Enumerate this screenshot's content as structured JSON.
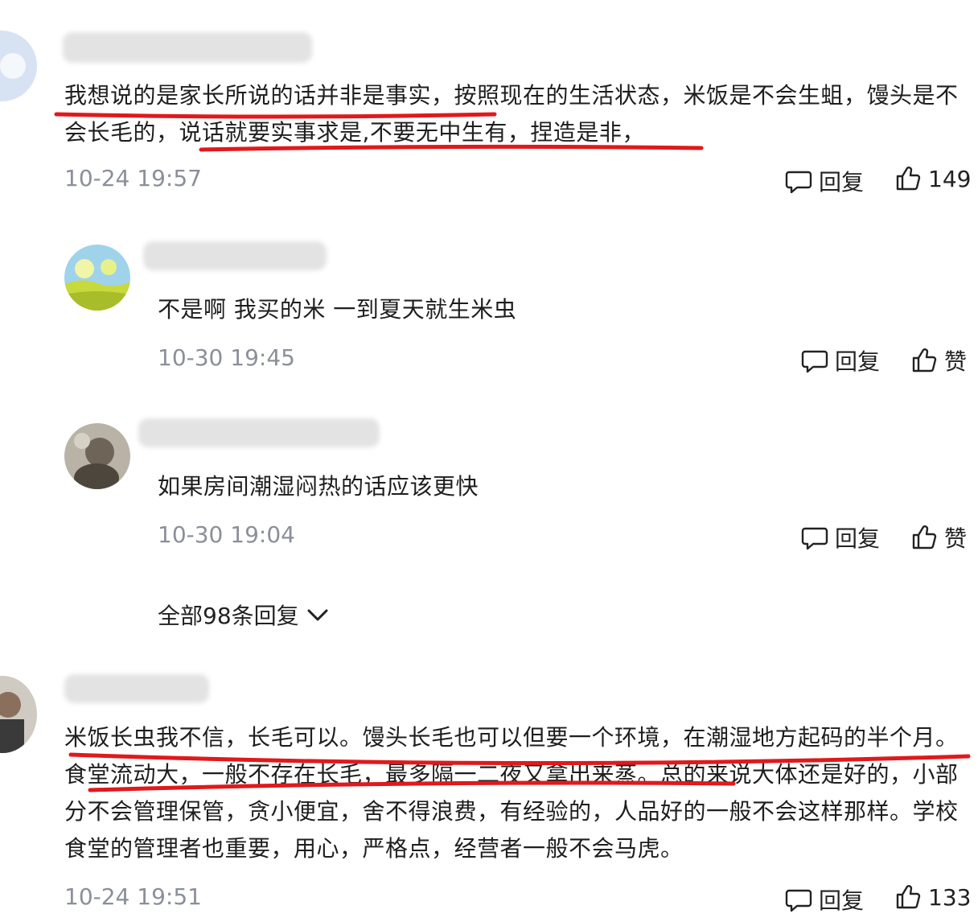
{
  "comments": [
    {
      "text": "我想说的是家长所说的话并非是事实，按照现在的生活状态，米饭是不会生蛆，馒头是不会长毛的，说话就要实事求是,不要无中生有，捏造是非，",
      "time": "10-24 19:57",
      "reply_label": "回复",
      "like_label": "149"
    },
    {
      "text": "不是啊 我买的米 一到夏天就生米虫",
      "time": "10-30 19:45",
      "reply_label": "回复",
      "like_label": "赞"
    },
    {
      "text": "如果房间潮湿闷热的话应该更快",
      "time": "10-30 19:04",
      "reply_label": "回复",
      "like_label": "赞"
    },
    {
      "text": "米饭长虫我不信，长毛可以。馒头长毛也可以但要一个环境，在潮湿地方起码的半个月。食堂流动大，一般不存在长毛，最多隔一二夜又拿出来蒸。总的来说大体还是好的，小部分不会管理保管，贪小便宜，舍不得浪费，有经验的，人品好的一般不会这样那样。学校食堂的管理者也重要，用心，严格点，经营者一般不会马虎。",
      "time": "10-24 19:51",
      "reply_label": "回复",
      "like_label": "133"
    }
  ],
  "all_replies_label": "全部98条回复",
  "colors": {
    "underline": "#e0191c",
    "time": "#8a8f99"
  }
}
